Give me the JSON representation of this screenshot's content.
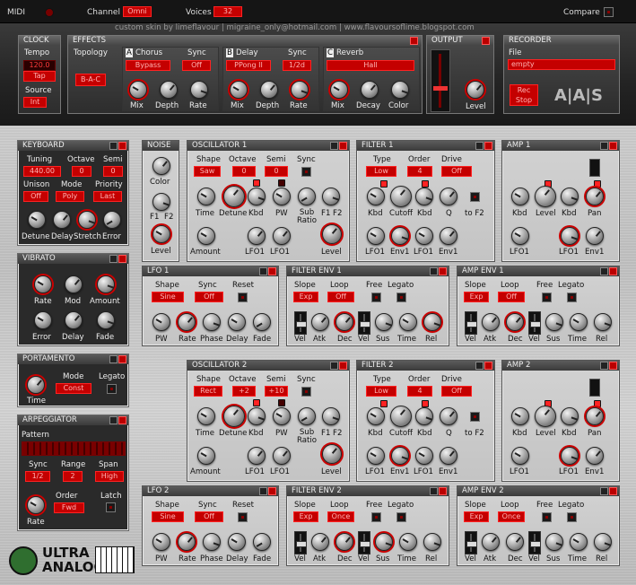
{
  "top": {
    "midi": "MIDI",
    "channel": "Channel",
    "channel_value": "Omni",
    "voices": "Voices",
    "voices_value": "32",
    "compare": "Compare",
    "credit": "custom skin by limeflavour  |  migraine_only@hotmail.com  |  www.flavoursoflime.blogspot.com"
  },
  "clock": {
    "title": "CLOCK",
    "tempo": "Tempo",
    "tempo_value": "120.0",
    "tap": "Tap",
    "source": "Source",
    "source_value": "Int"
  },
  "effects": {
    "title": "EFFECTS",
    "topology": "Topology",
    "topology_value": "B-A-C",
    "chorus": {
      "badge": "A",
      "name": "Chorus",
      "sync": "Sync",
      "type_value": "Bypass",
      "sync_value": "Off",
      "k1": "Mix",
      "k2": "Depth",
      "k3": "Rate"
    },
    "delay": {
      "badge": "B",
      "name": "Delay",
      "sync": "Sync",
      "type_value": "PPong II",
      "sync_value": "1/2d",
      "k1": "Mix",
      "k2": "Depth",
      "k3": "Rate"
    },
    "reverb": {
      "badge": "C",
      "name": "Reverb",
      "type_value": "Hall",
      "k1": "Mix",
      "k2": "Decay",
      "k3": "Color"
    }
  },
  "output": {
    "title": "OUTPUT",
    "level": "Level"
  },
  "recorder": {
    "title": "RECORDER",
    "file": "File",
    "file_value": "empty",
    "rec": "Rec",
    "stop": "Stop",
    "logo": "A|A|S"
  },
  "keyboard": {
    "title": "KEYBOARD",
    "tuning": "Tuning",
    "tuning_value": "440.00",
    "octave": "Octave",
    "octave_value": "0",
    "semi": "Semi",
    "semi_value": "0",
    "unison": "Unison",
    "unison_value": "Off",
    "mode": "Mode",
    "mode_value": "Poly",
    "priority": "Priority",
    "priority_value": "Last",
    "k1": "Detune",
    "k2": "Delay",
    "k3": "Stretch",
    "k4": "Error"
  },
  "vibrato": {
    "title": "VIBRATO",
    "k1": "Rate",
    "k2": "Mod",
    "k3": "Amount",
    "k4": "Error",
    "k5": "Delay",
    "k6": "Fade"
  },
  "portamento": {
    "title": "PORTAMENTO",
    "mode": "Mode",
    "mode_value": "Const",
    "legato": "Legato",
    "time": "Time"
  },
  "arpeggiator": {
    "title": "ARPEGGIATOR",
    "pattern": "Pattern",
    "sync": "Sync",
    "sync_value": "1/2",
    "range": "Range",
    "range_value": "2",
    "span": "Span",
    "span_value": "High",
    "order": "Order",
    "order_value": "Fwd",
    "latch": "Latch",
    "rate": "Rate"
  },
  "logo": {
    "line1": "ULTRA",
    "line2": "ANALOG"
  },
  "noise": {
    "title": "NOISE",
    "color": "Color",
    "f1": "F1",
    "f2": "F2",
    "level": "Level"
  },
  "osc1": {
    "title": "OSCILLATOR 1",
    "shape": "Shape",
    "shape_value": "Saw",
    "octave": "Octave",
    "octave_value": "0",
    "semi": "Semi",
    "semi_value": "0",
    "sync": "Sync",
    "time": "Time",
    "detune": "Detune",
    "kbd": "Kbd",
    "pw": "PW",
    "subratio": "Sub Ratio",
    "f1": "F1",
    "f2": "F2",
    "amount": "Amount",
    "lfo1": "LFO1",
    "lfo1b": "LFO1",
    "level": "Level"
  },
  "filter1": {
    "title": "FILTER 1",
    "type": "Type",
    "type_value": "Low",
    "order": "Order",
    "order_value": "4",
    "drive": "Drive",
    "drive_value": "Off",
    "kbd": "Kbd",
    "cutoff": "Cutoff",
    "kbd2": "Kbd",
    "q": "Q",
    "tof2": "to F2",
    "lfo1": "LFO1",
    "env1": "Env1",
    "lfo1b": "LFO1",
    "env1b": "Env1"
  },
  "amp1": {
    "title": "AMP 1",
    "kbd": "Kbd",
    "level": "Level",
    "kbd2": "Kbd",
    "pan": "Pan",
    "lfo1": "LFO1",
    "lfo1b": "LFO1",
    "env1": "Env1"
  },
  "lfo1": {
    "title": "LFO 1",
    "shape": "Shape",
    "shape_value": "Sine",
    "sync": "Sync",
    "sync_value": "Off",
    "reset": "Reset",
    "k1": "PW",
    "k2": "Rate",
    "k3": "Phase",
    "k4": "Delay",
    "k5": "Fade"
  },
  "fenv1": {
    "title": "FILTER ENV 1",
    "slope": "Slope",
    "slope_value": "Exp",
    "loop": "Loop",
    "loop_value": "Off",
    "free": "Free",
    "legato": "Legato",
    "vel": "Vel",
    "atk": "Atk",
    "dec": "Dec",
    "vel2": "Vel",
    "sus": "Sus",
    "time": "Time",
    "rel": "Rel"
  },
  "aenv1": {
    "title": "AMP ENV 1",
    "slope": "Slope",
    "slope_value": "Exp",
    "loop": "Loop",
    "loop_value": "Off",
    "free": "Free",
    "legato": "Legato",
    "vel": "Vel",
    "atk": "Atk",
    "dec": "Dec",
    "vel2": "Vel",
    "sus": "Sus",
    "time": "Time",
    "rel": "Rel"
  },
  "osc2": {
    "title": "OSCILLATOR 2",
    "shape": "Shape",
    "shape_value": "Rect",
    "octave": "Octave",
    "octave_value": "+2",
    "semi": "Semi",
    "semi_value": "+10",
    "sync": "Sync",
    "time": "Time",
    "detune": "Detune",
    "kbd": "Kbd",
    "pw": "PW",
    "subratio": "Sub Ratio",
    "f1": "F1",
    "f2": "F2",
    "amount": "Amount",
    "lfo1": "LFO1",
    "lfo1b": "LFO1",
    "level": "Level"
  },
  "filter2": {
    "title": "FILTER 2",
    "type": "Type",
    "type_value": "Low",
    "order": "Order",
    "order_value": "4",
    "drive": "Drive",
    "drive_value": "Off",
    "kbd": "Kbd",
    "cutoff": "Cutoff",
    "kbd2": "Kbd",
    "q": "Q",
    "tof2": "to F2",
    "lfo1": "LFO1",
    "env1": "Env1",
    "lfo1b": "LFO1",
    "env1b": "Env1"
  },
  "amp2": {
    "title": "AMP 2",
    "kbd": "Kbd",
    "level": "Level",
    "kbd2": "Kbd",
    "pan": "Pan",
    "lfo1": "LFO1",
    "lfo1b": "LFO1",
    "env1": "Env1"
  },
  "lfo2": {
    "title": "LFO 2",
    "shape": "Shape",
    "shape_value": "Sine",
    "sync": "Sync",
    "sync_value": "Off",
    "reset": "Reset",
    "k1": "PW",
    "k2": "Rate",
    "k3": "Phase",
    "k4": "Delay",
    "k5": "Fade"
  },
  "fenv2": {
    "title": "FILTER ENV 2",
    "slope": "Slope",
    "slope_value": "Exp",
    "loop": "Loop",
    "loop_value": "Once",
    "free": "Free",
    "legato": "Legato",
    "vel": "Vel",
    "atk": "Atk",
    "dec": "Dec",
    "vel2": "Vel",
    "sus": "Sus",
    "time": "Time",
    "rel": "Rel"
  },
  "aenv2": {
    "title": "AMP ENV 2",
    "slope": "Slope",
    "slope_value": "Exp",
    "loop": "Loop",
    "loop_value": "Once",
    "free": "Free",
    "legato": "Legato",
    "vel": "Vel",
    "atk": "Atk",
    "dec": "Dec",
    "vel2": "Vel",
    "sus": "Sus",
    "time": "Time",
    "rel": "Rel"
  }
}
